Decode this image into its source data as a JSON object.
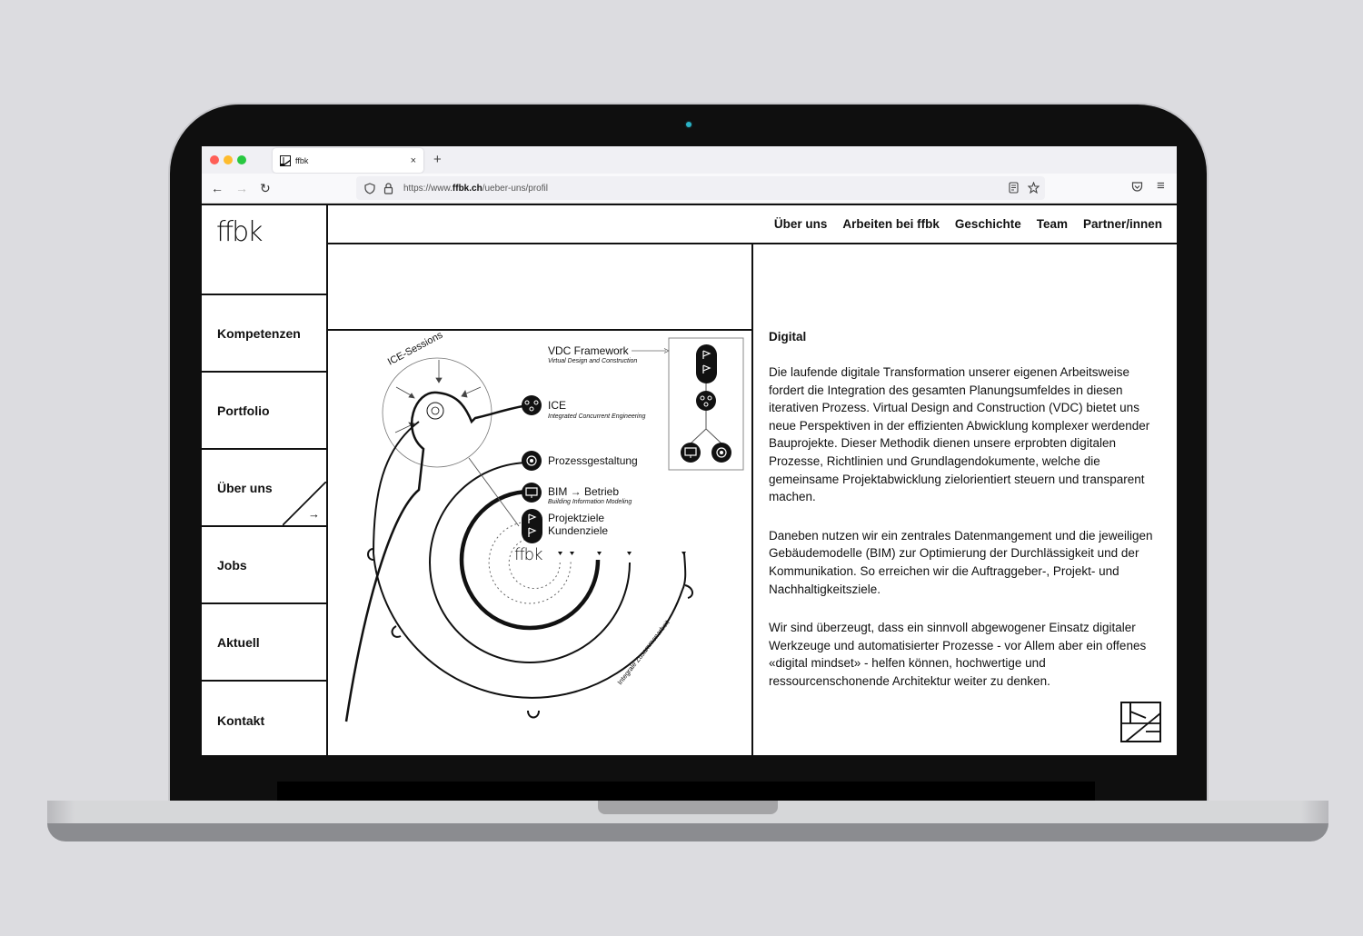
{
  "browser": {
    "tab_title": "ffbk",
    "tab_close": "×",
    "new_tab": "+",
    "url_prefix": "https://www.",
    "url_domain": "ffbk.ch",
    "url_path": "/ueber-uns/profil",
    "back": "←",
    "forward": "→",
    "reload": "↻",
    "menu": "≡"
  },
  "site": {
    "logo": "ffbk",
    "topnav": [
      "Über uns",
      "Arbeiten bei ffbk",
      "Geschichte",
      "Team",
      "Partner/innen"
    ],
    "sidebar": [
      "Kompetenzen",
      "Portfolio",
      "Über uns",
      "Jobs",
      "Aktuell",
      "Kontakt"
    ],
    "active_sidebar": "Über uns",
    "active_arrow": "→"
  },
  "diagram": {
    "ice_sessions": "ICE-Sessions",
    "vdc_title": "VDC Framework",
    "vdc_sub": "Virtual Design and Construction",
    "ice_title": "ICE",
    "ice_sub": "Integrated Concurrent Engineering",
    "prozess": "Prozessgestaltung",
    "bim_title": "BIM → Betrieb",
    "bim_sub": "Building Information Modeling",
    "projektziele": "Projektziele",
    "kundenziele": "Kundenziele",
    "center_logo": "ffbk",
    "arc_label": "Integrale Zusammenarbeit"
  },
  "content": {
    "heading": "Digital",
    "paragraphs": [
      "Die laufende digitale Transformation unserer eigenen Arbeitsweise fordert die Integration des gesamten Planungsumfeldes in diesen iterativen Prozess. Virtual Design and Construction (VDC) bietet uns neue Perspektiven in der effizienten Abwicklung komplexer werdender Bauprojekte. Dieser Methodik dienen unsere erprobten digitalen Prozesse, Richtlinien und Grundlagendokumente, welche die gemeinsame Projektabwicklung zielorientiert steuern und transparent machen.",
      "Daneben nutzen wir ein zentrales Datenmangement und die jeweiligen Gebäudemodelle (BIM) zur Optimierung der Durchlässigkeit und der Kommunikation. So erreichen wir die Auftraggeber-, Projekt- und Nachhaltigkeitsziele.",
      "Wir sind überzeugt, dass ein sinnvoll abgewogener Einsatz digitaler Werkzeuge und automatisierter Prozesse - vor Allem aber ein offenes «digital mindset» - helfen können, hochwertige und ressourcenschonende Architektur weiter zu denken."
    ]
  },
  "colors": {
    "ink": "#111111",
    "camera": "#2ab3c6",
    "traffic_red": "#ff5f57",
    "traffic_yellow": "#febc2e",
    "traffic_green": "#28c840"
  }
}
